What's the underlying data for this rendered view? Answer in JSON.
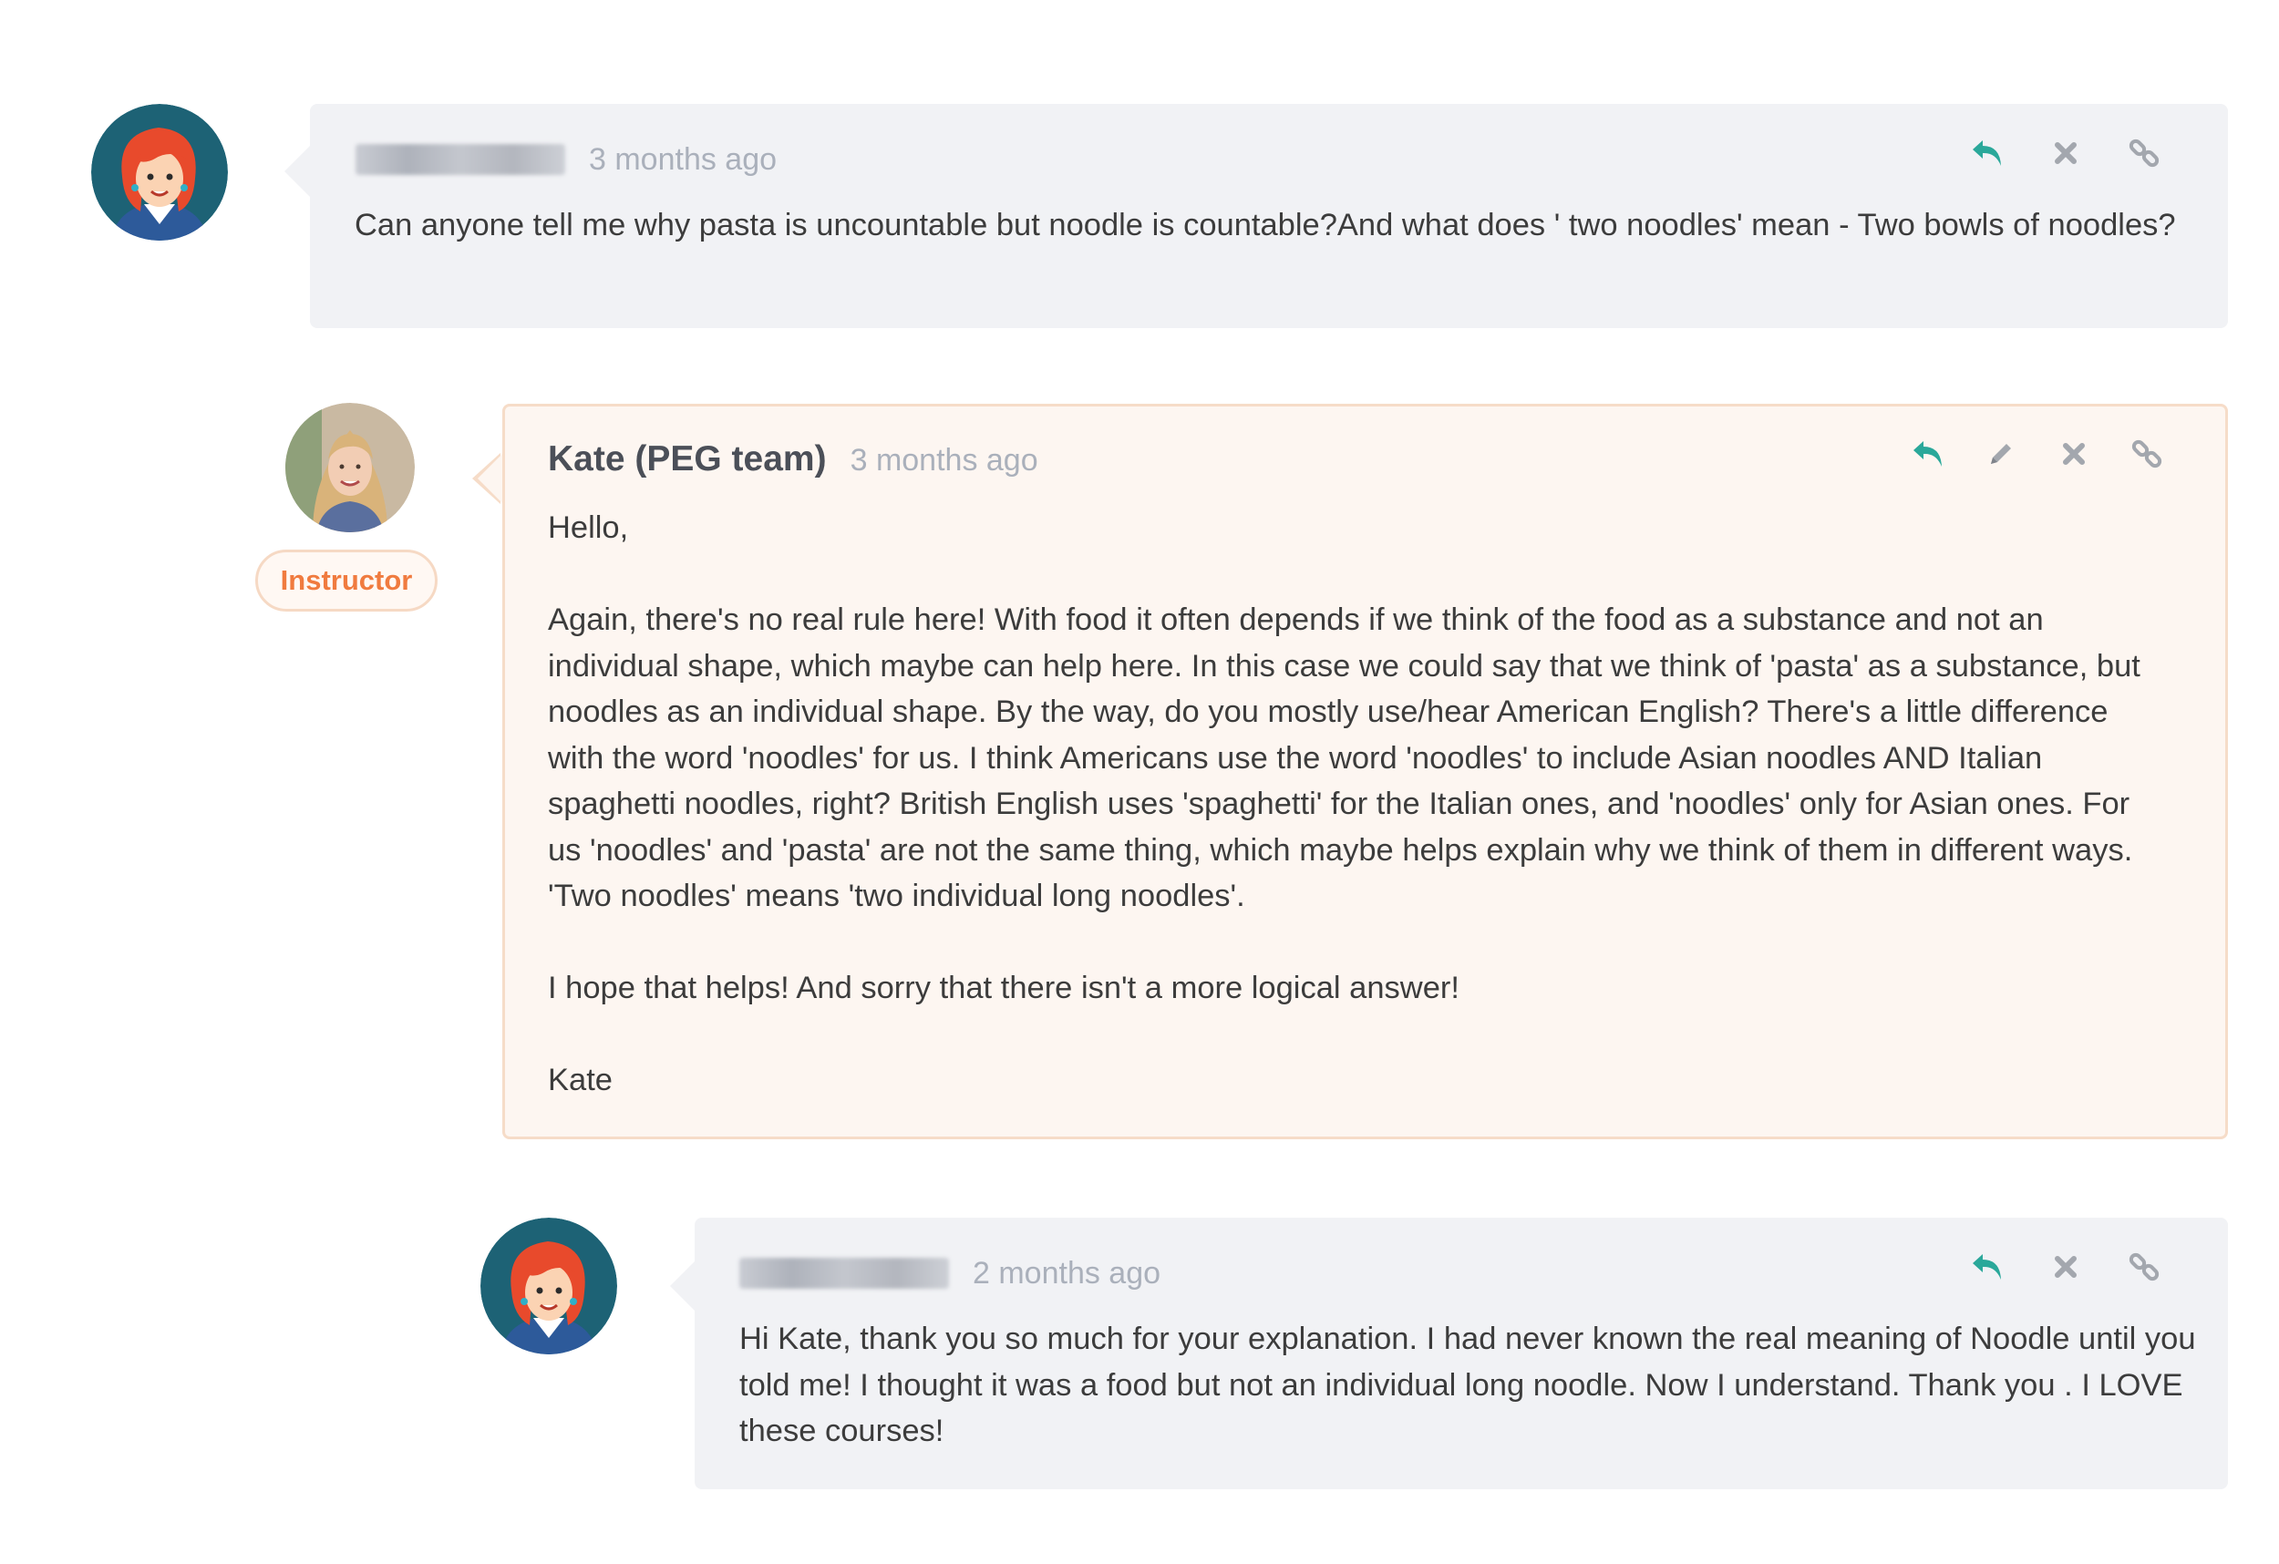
{
  "colors": {
    "reply_icon": "#2aa89a",
    "muted_icon": "#a3a7ae",
    "instructor_accent": "#f07b3f",
    "bubble_gray": "#f1f2f5",
    "bubble_instructor": "#fdf6f1"
  },
  "icons": [
    "reply-icon",
    "edit-icon",
    "delete-icon",
    "link-icon"
  ],
  "comments": [
    {
      "author": "Helen ZHOU",
      "author_blurred": true,
      "time": "3 months ago",
      "paragraphs": [
        "Can anyone tell me why pasta is uncountable but noodle is countable?And what does ' two noodles' mean - Two bowls of noodles?"
      ]
    },
    {
      "author": "Kate (PEG team)",
      "author_blurred": false,
      "badge": "Instructor",
      "time": "3 months ago",
      "paragraphs": [
        "Hello,",
        "Again, there's no real rule here!  With food it often depends if we think of the food as a substance and not an individual shape, which maybe can help here.  In this case we could say that we think of 'pasta' as a substance, but noodles as an individual shape.  By the way, do you mostly use/hear American English?  There's a little difference with the word 'noodles' for us.  I think Americans use the word 'noodles' to include Asian noodles AND Italian spaghetti noodles, right?  British English uses 'spaghetti' for the Italian ones, and 'noodles' only for Asian ones.  For us 'noodles' and 'pasta' are not the same thing, which maybe helps explain why we think of them in different ways.  'Two noodles' means 'two individual long noodles'.",
        "I hope that helps!  And sorry that there isn't a more logical answer!",
        "Kate"
      ]
    },
    {
      "author": "Helen ZHOU",
      "author_blurred": true,
      "time": "2 months ago",
      "paragraphs": [
        "Hi Kate, thank you so much for your explanation. I had never known the real meaning of Noodle until you told me!  I thought it was a food but not an individual long noodle. Now I understand. Thank you . I LOVE these courses!"
      ]
    }
  ]
}
